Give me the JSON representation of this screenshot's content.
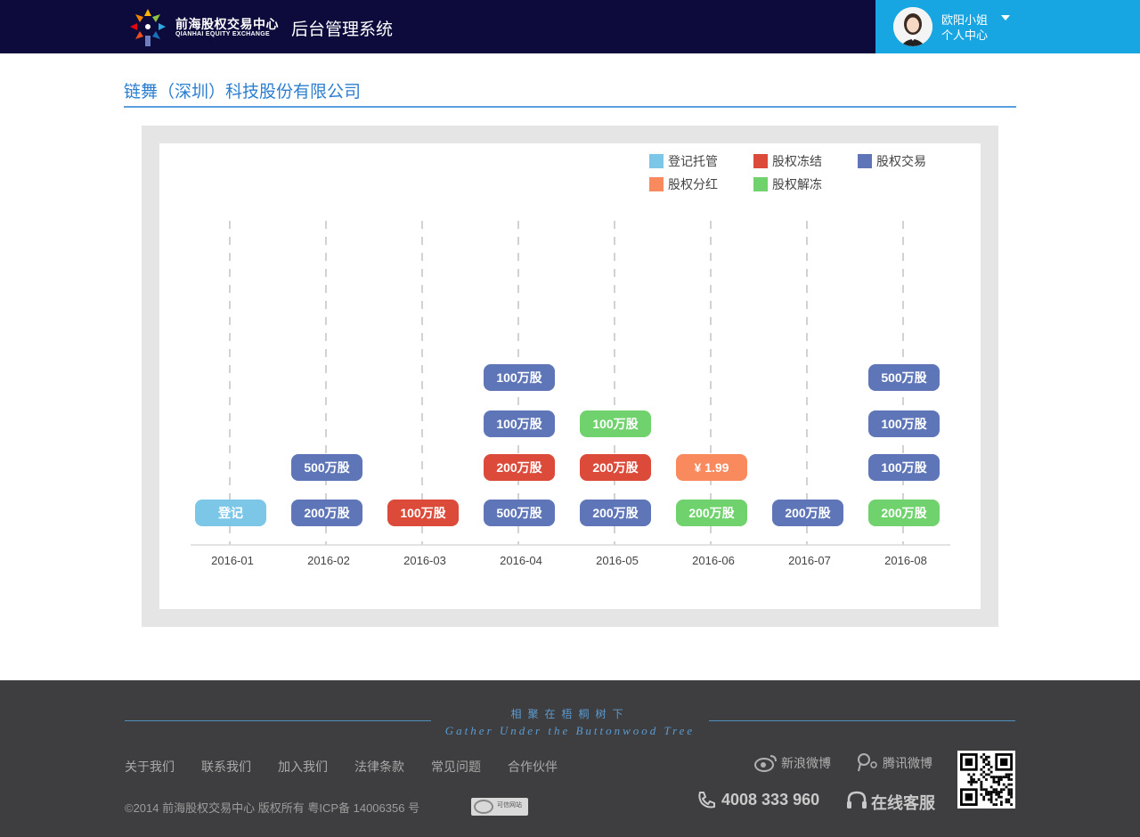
{
  "header": {
    "logo_cn": "前海股权交易中心",
    "logo_en": "QIANHAI EQUITY EXCHANGE",
    "system_title": "后台管理系统",
    "user_name": "欧阳小姐",
    "user_center": "个人中心"
  },
  "company_name": "链舞（深圳）科技股份有限公司",
  "legend": [
    {
      "label": "登记托管",
      "color": "#7cc6e8"
    },
    {
      "label": "股权冻结",
      "color": "#dc4a39"
    },
    {
      "label": "股权交易",
      "color": "#5e76b8"
    },
    {
      "label": "股权分红",
      "color": "#f98a5e"
    },
    {
      "label": "股权解冻",
      "color": "#6fd26d"
    }
  ],
  "timeline": {
    "months": [
      "2016-01",
      "2016-02",
      "2016-03",
      "2016-04",
      "2016-05",
      "2016-06",
      "2016-07",
      "2016-08"
    ],
    "events": [
      {
        "month": "2016-01",
        "type": "登记托管",
        "label": "登记",
        "order": 0
      },
      {
        "month": "2016-02",
        "type": "股权交易",
        "label": "200万股",
        "order": 0
      },
      {
        "month": "2016-02",
        "type": "股权交易",
        "label": "500万股",
        "order": 1
      },
      {
        "month": "2016-03",
        "type": "股权冻结",
        "label": "100万股",
        "order": 0
      },
      {
        "month": "2016-04",
        "type": "股权交易",
        "label": "500万股",
        "order": 0
      },
      {
        "month": "2016-04",
        "type": "股权冻结",
        "label": "200万股",
        "order": 1
      },
      {
        "month": "2016-04",
        "type": "股权交易",
        "label": "100万股",
        "order": 2
      },
      {
        "month": "2016-04",
        "type": "股权交易",
        "label": "100万股",
        "order": 3
      },
      {
        "month": "2016-05",
        "type": "股权交易",
        "label": "200万股",
        "order": 0
      },
      {
        "month": "2016-05",
        "type": "股权冻结",
        "label": "200万股",
        "order": 1
      },
      {
        "month": "2016-05",
        "type": "股权解冻",
        "label": "100万股",
        "order": 2
      },
      {
        "month": "2016-06",
        "type": "股权解冻",
        "label": "200万股",
        "order": 0
      },
      {
        "month": "2016-06",
        "type": "股权分红",
        "label": "¥ 1.99",
        "order": 1
      },
      {
        "month": "2016-07",
        "type": "股权交易",
        "label": "200万股",
        "order": 0
      },
      {
        "month": "2016-08",
        "type": "股权解冻",
        "label": "200万股",
        "order": 0
      },
      {
        "month": "2016-08",
        "type": "股权交易",
        "label": "100万股",
        "order": 1
      },
      {
        "month": "2016-08",
        "type": "股权交易",
        "label": "100万股",
        "order": 2
      },
      {
        "month": "2016-08",
        "type": "股权交易",
        "label": "500万股",
        "order": 3
      }
    ]
  },
  "footer": {
    "slogan_cn": "相聚在梧桐树下",
    "slogan_en": "Gather Under the Buttonwood Tree",
    "links": [
      "关于我们",
      "联系我们",
      "加入我们",
      "法律条款",
      "常见问题",
      "合作伙伴"
    ],
    "copyright": "©2014 前海股权交易中心 版权所有    粤ICP备 14006356 号",
    "trust_badge": "可信网站",
    "weibo_sina": "新浪微博",
    "weibo_tencent": "腾讯微博",
    "phone": "4008 333 960",
    "online_service": "在线客服"
  }
}
